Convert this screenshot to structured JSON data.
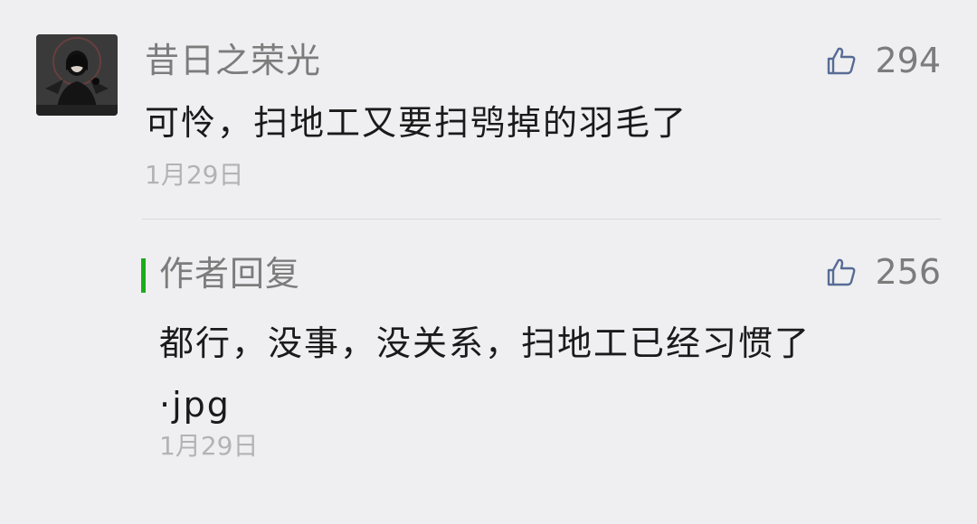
{
  "comment": {
    "username": "昔日之荣光",
    "likes": "294",
    "content": "可怜，扫地工又要扫鸮掉的羽毛了",
    "date": "1月29日",
    "avatar_icon": "avatar-image"
  },
  "reply": {
    "label": "作者回复",
    "likes": "256",
    "content_line1": "都行，没事，没关系，扫地工已经习惯了",
    "content_line2": "·jpg",
    "date": "1月29日",
    "accent_color": "#1aad19"
  },
  "icons": {
    "like": "thumbs-up-icon"
  },
  "colors": {
    "background": "#efeff1",
    "secondary_text": "#7c7c7c",
    "primary_text": "#1a1a1a",
    "date_text": "#b3b3b3",
    "like_icon": "#576b95"
  }
}
